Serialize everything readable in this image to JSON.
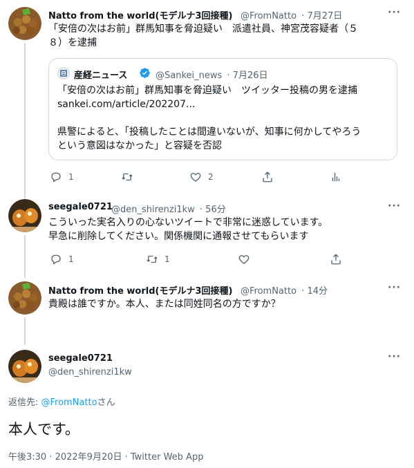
{
  "tweet1": {
    "name": "Natto from the world(モデルナ3回接種)",
    "handle": "@FromNatto",
    "time": "· 7月27日",
    "text_line1": "「安倍の次はお前」群馬知事を脅迫疑い　派遣社員、神宮茂容疑者（５",
    "text_line2": "８）を逮捕",
    "quote": {
      "name": "産経ニュース",
      "handle": "@Sankei_news",
      "time": "· 7月26日",
      "line1": "「安倍の次はお前」群馬知事を脅迫疑い　ツイッター投稿の男を逮捕",
      "line2": "sankei.com/article/202207...",
      "line3": "県警によると、「投稿したことは間違いないが、知事に何かしてやろう",
      "line4": "という意図はなかった」と容疑を否認"
    },
    "reply_count": "1",
    "like_count": "2"
  },
  "tweet2": {
    "name": "seegale0721",
    "handle": "@den_shirenzi1kw",
    "time": "· 56分",
    "text_line1": "こういった実名入りの心ないツイートで非常に迷惑しています。",
    "text_line2": "早急に削除してください。関係機関に通報させてもらいます",
    "reply_count": "1",
    "retweet_count": "1"
  },
  "tweet3": {
    "name": "Natto from the world(モデルナ3回接種)",
    "handle": "@FromNatto",
    "time": "· 14分",
    "text": "貴殿は誰ですか。本人、または同姓同名の方ですか？"
  },
  "main": {
    "name": "seegale0721",
    "handle": "@den_shirenzi1kw",
    "reply_to_prefix": "返信先: ",
    "reply_to_handle": "@FromNatto",
    "reply_to_suffix": "さん",
    "text": "本人です。",
    "meta": "午後3:30 · 2022年9月20日 · Twitter Web App"
  },
  "more_label": "···",
  "colors": {
    "accent": "#1d9bf0",
    "muted": "#536471",
    "line": "#cfd9de",
    "verified": "#1d9bf0"
  }
}
